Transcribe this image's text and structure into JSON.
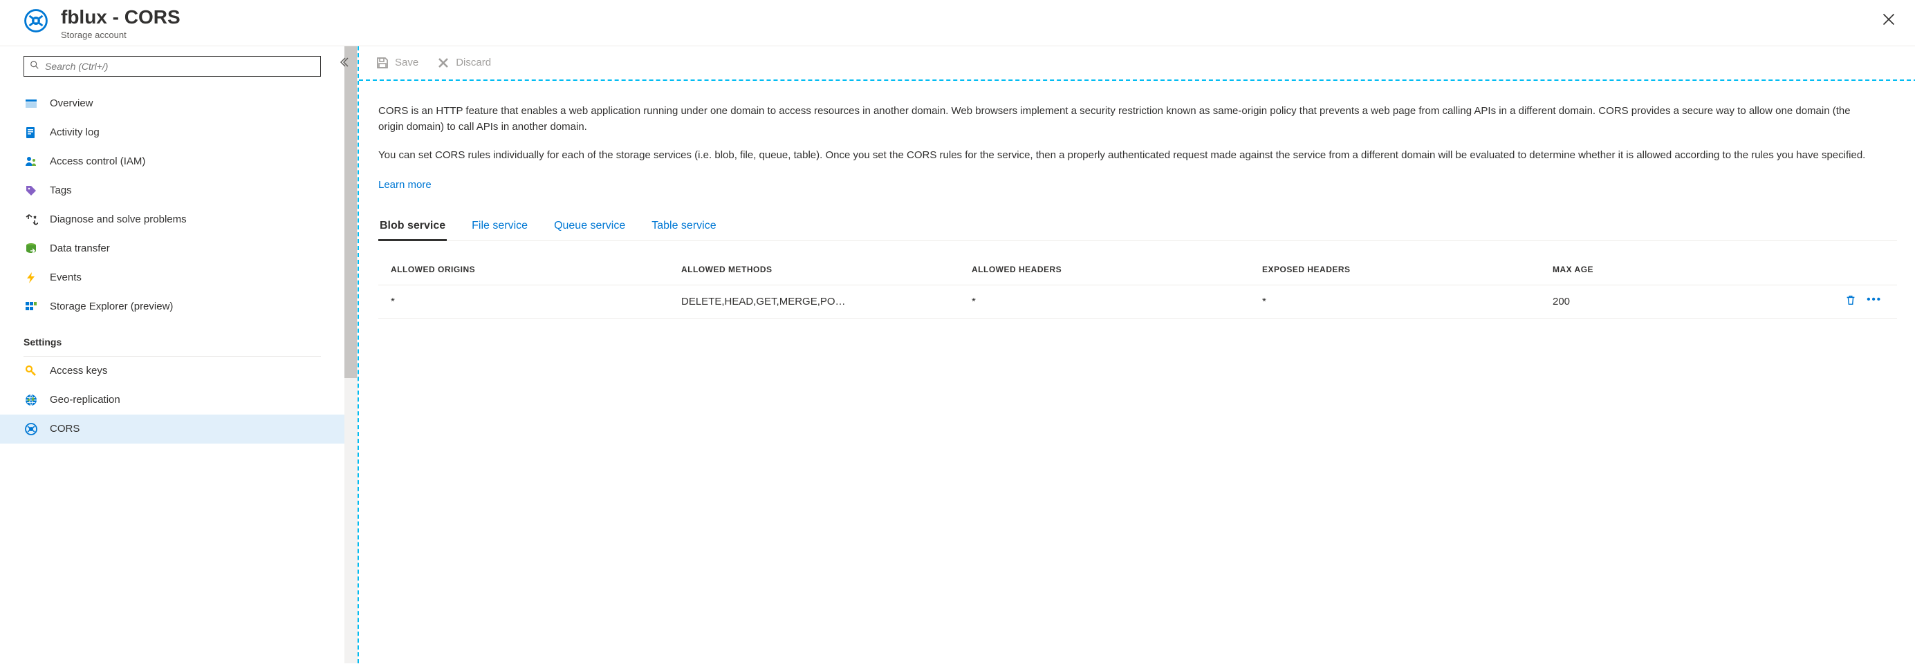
{
  "header": {
    "title": "fblux - CORS",
    "subtitle": "Storage account"
  },
  "search": {
    "placeholder": "Search (Ctrl+/)"
  },
  "sidebar": {
    "items": [
      {
        "label": "Overview"
      },
      {
        "label": "Activity log"
      },
      {
        "label": "Access control (IAM)"
      },
      {
        "label": "Tags"
      },
      {
        "label": "Diagnose and solve problems"
      },
      {
        "label": "Data transfer"
      },
      {
        "label": "Events"
      },
      {
        "label": "Storage Explorer (preview)"
      }
    ],
    "section": "Settings",
    "settings": [
      {
        "label": "Access keys"
      },
      {
        "label": "Geo-replication"
      },
      {
        "label": "CORS"
      }
    ]
  },
  "toolbar": {
    "save": "Save",
    "discard": "Discard"
  },
  "content": {
    "para1": "CORS is an HTTP feature that enables a web application running under one domain to access resources in another domain. Web browsers implement a security restriction known as same-origin policy that prevents a web page from calling APIs in a different domain. CORS provides a secure way to allow one domain (the origin domain) to call APIs in another domain.",
    "para2": "You can set CORS rules individually for each of the storage services (i.e. blob, file, queue, table). Once you set the CORS rules for the service, then a properly authenticated request made against the service from a different domain will be evaluated to determine whether it is allowed according to the rules you have specified.",
    "learn_more": "Learn more"
  },
  "tabs": [
    {
      "label": "Blob service",
      "active": true
    },
    {
      "label": "File service"
    },
    {
      "label": "Queue service"
    },
    {
      "label": "Table service"
    }
  ],
  "table": {
    "headers": {
      "origins": "ALLOWED ORIGINS",
      "methods": "ALLOWED METHODS",
      "headers": "ALLOWED HEADERS",
      "exposed": "EXPOSED HEADERS",
      "maxage": "MAX AGE"
    },
    "rows": [
      {
        "origins": "*",
        "methods": "DELETE,HEAD,GET,MERGE,PO…",
        "headers": "*",
        "exposed": "*",
        "maxage": "200"
      }
    ]
  }
}
